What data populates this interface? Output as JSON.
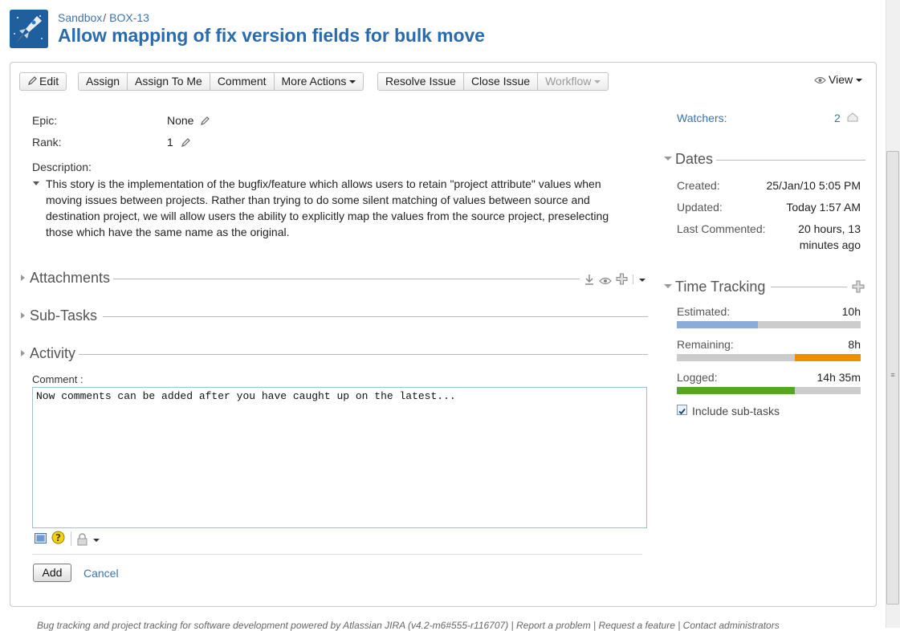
{
  "header": {
    "breadcrumb": {
      "project": "Sandbox",
      "separator": "/",
      "issue_key": "BOX-13"
    },
    "title": "Allow mapping of fix version fields for bulk move"
  },
  "toolbar": {
    "edit": "Edit",
    "assign": "Assign",
    "assign_to_me": "Assign To Me",
    "comment": "Comment",
    "more_actions": "More Actions",
    "resolve_issue": "Resolve Issue",
    "close_issue": "Close Issue",
    "workflow": "Workflow",
    "view": "View"
  },
  "details": {
    "epic_label": "Epic:",
    "epic_value": "None",
    "rank_label": "Rank:",
    "rank_value": "1",
    "description_label": "Description:",
    "description": "This story is the implementation of the bugfix/feature which allows users to retain \"project attribute\" values when moving issues between projects. Rather than trying to do some silent matching of values between source and destination project, we will allow users the ability to explicitly map the values from the source project, preselecting those which have the same name as the original."
  },
  "sections": {
    "attachments": "Attachments",
    "subtasks": "Sub-Tasks",
    "activity": "Activity"
  },
  "comment": {
    "label": "Comment :",
    "value": "Now comments can be added after you have caught up on the latest...",
    "add": "Add",
    "cancel": "Cancel"
  },
  "sidebar": {
    "watchers_label": "Watchers:",
    "watchers_count": "2",
    "dates_title": "Dates",
    "created_label": "Created:",
    "created_value": "25/Jan/10 5:05 PM",
    "updated_label": "Updated:",
    "updated_value": "Today 1:57 AM",
    "last_commented_label": "Last Commented:",
    "last_commented_line1": "20 hours, 13",
    "last_commented_line2": "minutes ago",
    "time_tracking_title": "Time Tracking",
    "estimated_label": "Estimated:",
    "estimated_value": "10h",
    "estimated_fraction": 0.44,
    "remaining_label": "Remaining:",
    "remaining_value": "8h",
    "remaining_fraction": 0.36,
    "logged_label": "Logged:",
    "logged_value": "14h 35m",
    "logged_fraction": 0.64,
    "include_subtasks": "Include sub-tasks",
    "include_subtasks_checked": true
  },
  "colors": {
    "estimated": "#89acd8",
    "remaining": "#ec8e00",
    "logged": "#51a825",
    "link": "#3b73af",
    "title": "#2a6aad"
  },
  "footer": {
    "text": "Bug tracking and project tracking for software development powered by Atlassian JIRA (v4.2-m6#555-r116707)  |  Report a problem  |  Request a feature  |  Contact administrators"
  }
}
